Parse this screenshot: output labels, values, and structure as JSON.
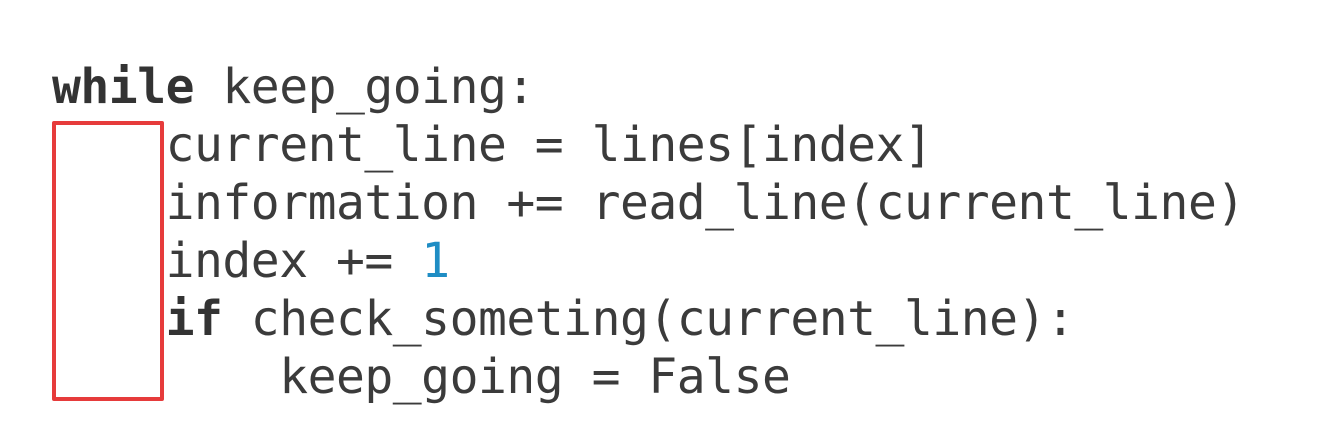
{
  "highlight": {
    "color": "#e63b3b"
  },
  "colors": {
    "text": "#3b3b3b",
    "keyword": "#333333",
    "number": "#1f8dc4",
    "background": "#ffffff"
  },
  "code": {
    "line1": {
      "indent": "",
      "keyword": "while",
      "rest": " keep_going:"
    },
    "line2": {
      "indent": "    ",
      "text": "current_line = lines[index]"
    },
    "line3": {
      "indent": "    ",
      "text": "information += read_line(current_line)"
    },
    "line4": {
      "indent": "    ",
      "text": "index += ",
      "number": "1"
    },
    "line5": {
      "indent": "    ",
      "keyword": "if",
      "rest": " check_someting(current_line):"
    },
    "line6": {
      "indent": "        ",
      "text": "keep_going = False"
    }
  }
}
